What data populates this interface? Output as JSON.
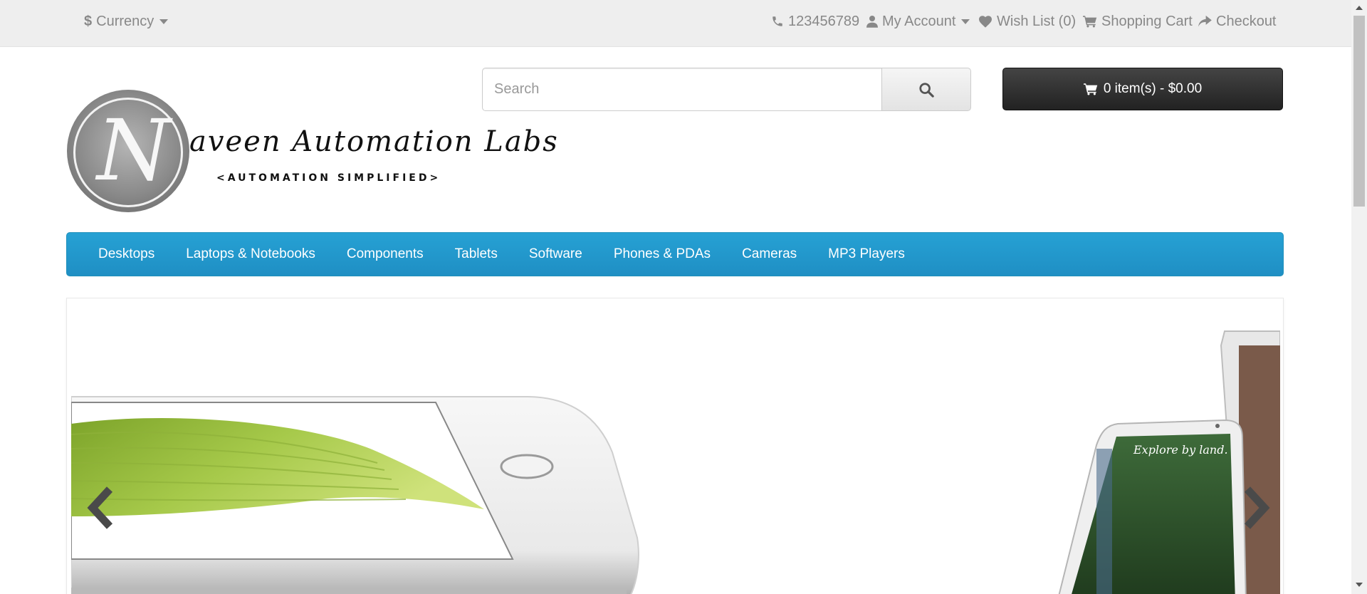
{
  "topbar": {
    "currency_label": "Currency",
    "currency_symbol": "$",
    "phone": "123456789",
    "account_label": "My Account",
    "wishlist_label": "Wish List (0)",
    "cart_label": "Shopping Cart",
    "checkout_label": "Checkout"
  },
  "logo": {
    "letter": "N",
    "name": "aveen Automation Labs",
    "tagline": "<AUTOMATION SIMPLIFIED>"
  },
  "search": {
    "placeholder": "Search",
    "value": ""
  },
  "cart": {
    "button_label": "0 item(s) - $0.00"
  },
  "menu": {
    "items": [
      {
        "label": "Desktops"
      },
      {
        "label": "Laptops & Notebooks"
      },
      {
        "label": "Components"
      },
      {
        "label": "Tablets"
      },
      {
        "label": "Software"
      },
      {
        "label": "Phones & PDAs"
      },
      {
        "label": "Cameras"
      },
      {
        "label": "MP3 Players"
      }
    ]
  },
  "slideshow": {
    "slide_caption_text": "Explore by land."
  },
  "colors": {
    "topbar_bg": "#eeeeee",
    "menu_bg": "#229ac8",
    "cart_button_bg": "#303030"
  },
  "icons": {
    "currency": "dollar-icon",
    "phone": "phone-icon",
    "account": "user-icon",
    "wishlist": "heart-icon",
    "cart": "cart-icon",
    "checkout": "share-icon",
    "search": "search-icon",
    "prev": "chevron-left-icon",
    "next": "chevron-right-icon"
  }
}
